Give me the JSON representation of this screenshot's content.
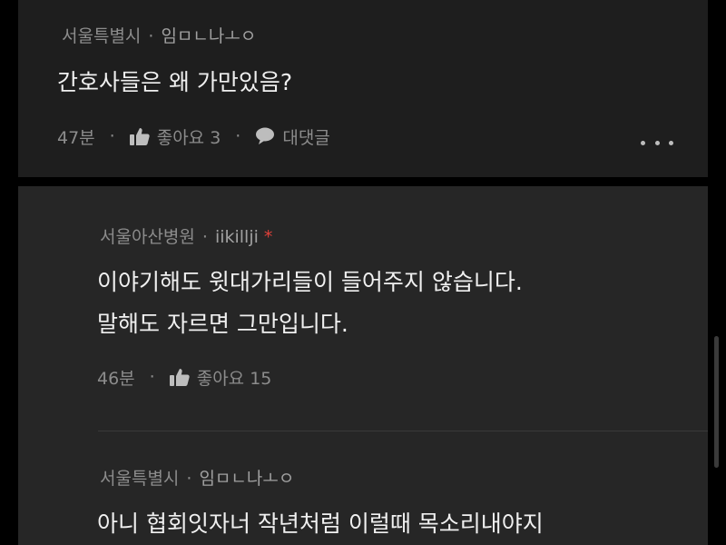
{
  "comments": [
    {
      "location": "서울특별시",
      "author": "임ㅁㄴ나ㅗㅇ",
      "text": [
        "간호사들은 왜 가만있음?"
      ],
      "time": "47분",
      "like_label": "좋아요 3",
      "reply_label": "대댓글"
    },
    {
      "location": "서울아산병원",
      "author": "iikillji",
      "badge": "*",
      "text": [
        "이야기해도 윗대가리들이 들어주지 않습니다.",
        "말해도 자르면 그만입니다."
      ],
      "time": "46분",
      "like_label": "좋아요 15"
    },
    {
      "location": "서울특별시",
      "author": "임ㅁㄴ나ㅗㅇ",
      "text": [
        "아니 협회잇자너 작년처럼 이럴때 목소리내야지"
      ]
    }
  ],
  "separator": "·",
  "colors": {
    "background": "#000000",
    "main_panel": "#1e1e1e",
    "reply_panel": "#262626",
    "meta_text": "#8c8c8c",
    "body_text": "#f0f0f0",
    "badge": "#e0413a"
  },
  "icons": {
    "like": "thumbs-up-icon",
    "reply": "speech-bubble-icon",
    "more": "more-dots-icon"
  }
}
